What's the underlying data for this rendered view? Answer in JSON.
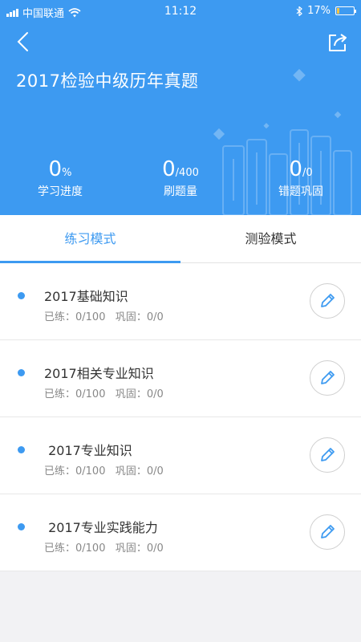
{
  "status_bar": {
    "carrier": "中国联通",
    "time": "11:12",
    "battery": "17%"
  },
  "header": {
    "title": "2017检验中级历年真题"
  },
  "stats": [
    {
      "value": "0",
      "unit": "%",
      "label": "学习进度"
    },
    {
      "value": "0",
      "unit": "/400",
      "label": "刷题量"
    },
    {
      "value": "0",
      "unit": "/0",
      "label": "错题巩固"
    }
  ],
  "tabs": [
    {
      "label": "练习模式",
      "active": true
    },
    {
      "label": "测验模式",
      "active": false
    }
  ],
  "items": [
    {
      "name": "2017基础知识",
      "practiced": "已练：0/100",
      "consolidated": "巩固：0/0"
    },
    {
      "name": "2017相关专业知识",
      "practiced": "已练：0/100",
      "consolidated": "巩固：0/0"
    },
    {
      "name": " 2017专业知识",
      "practiced": "已练：0/100",
      "consolidated": "巩固：0/0"
    },
    {
      "name": " 2017专业实践能力",
      "practiced": "已练：0/100",
      "consolidated": "巩固：0/0"
    }
  ],
  "colors": {
    "primary": "#3d9af1",
    "battery_low": "#f6c342"
  }
}
